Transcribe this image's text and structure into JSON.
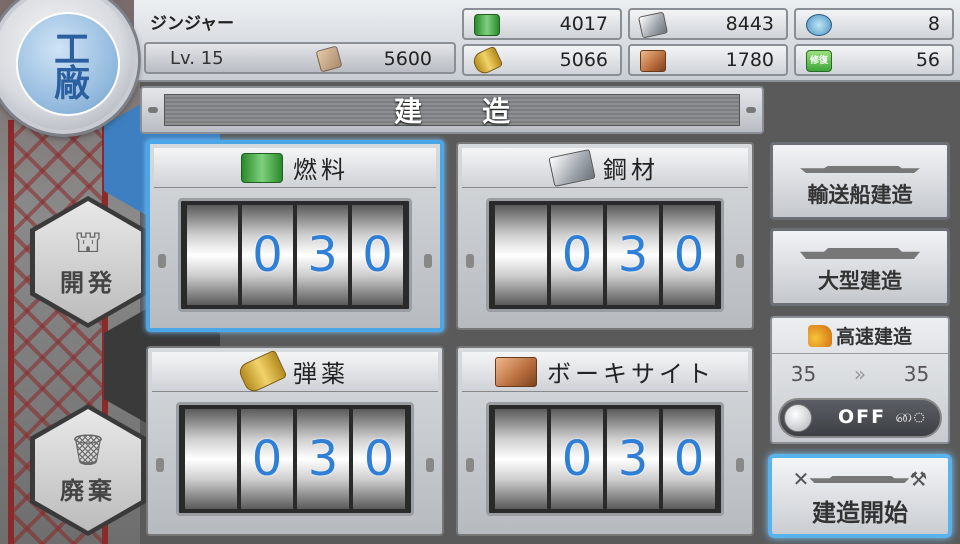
{
  "emblem": {
    "text": "工廠"
  },
  "player": {
    "name": "ジンジャー",
    "level": "Lv. 15",
    "coins": "5600"
  },
  "resources": {
    "fuel": "4017",
    "steel": "8443",
    "dev_material": "8",
    "ammo": "5066",
    "bauxite": "1780",
    "instant_repair": "56",
    "instant_repair_icon_text": "修復"
  },
  "title": "建造",
  "panels": [
    {
      "label": "燃料",
      "digits": [
        "",
        "0",
        "3",
        "0"
      ],
      "icon": "fuel-barrels-icon"
    },
    {
      "label": "鋼材",
      "digits": [
        "",
        "0",
        "3",
        "0"
      ],
      "icon": "steel-ingot-icon"
    },
    {
      "label": "弾薬",
      "digits": [
        "",
        "0",
        "3",
        "0"
      ],
      "icon": "ammo-shells-icon"
    },
    {
      "label": "ボーキサイト",
      "digits": [
        "",
        "0",
        "3",
        "0"
      ],
      "icon": "bauxite-ore-icon"
    }
  ],
  "side_menu": {
    "develop": "開発",
    "scrap": "廃棄"
  },
  "right": {
    "transport_build": "輸送船建造",
    "large_build": "大型建造",
    "fast_build": "高速建造",
    "fast_from": "35",
    "fast_to": "35",
    "toggle_state": "OFF",
    "start_build": "建造開始"
  },
  "colors": {
    "selected_border": "#4aa6e6",
    "digit_color": "#2f7fd6"
  }
}
